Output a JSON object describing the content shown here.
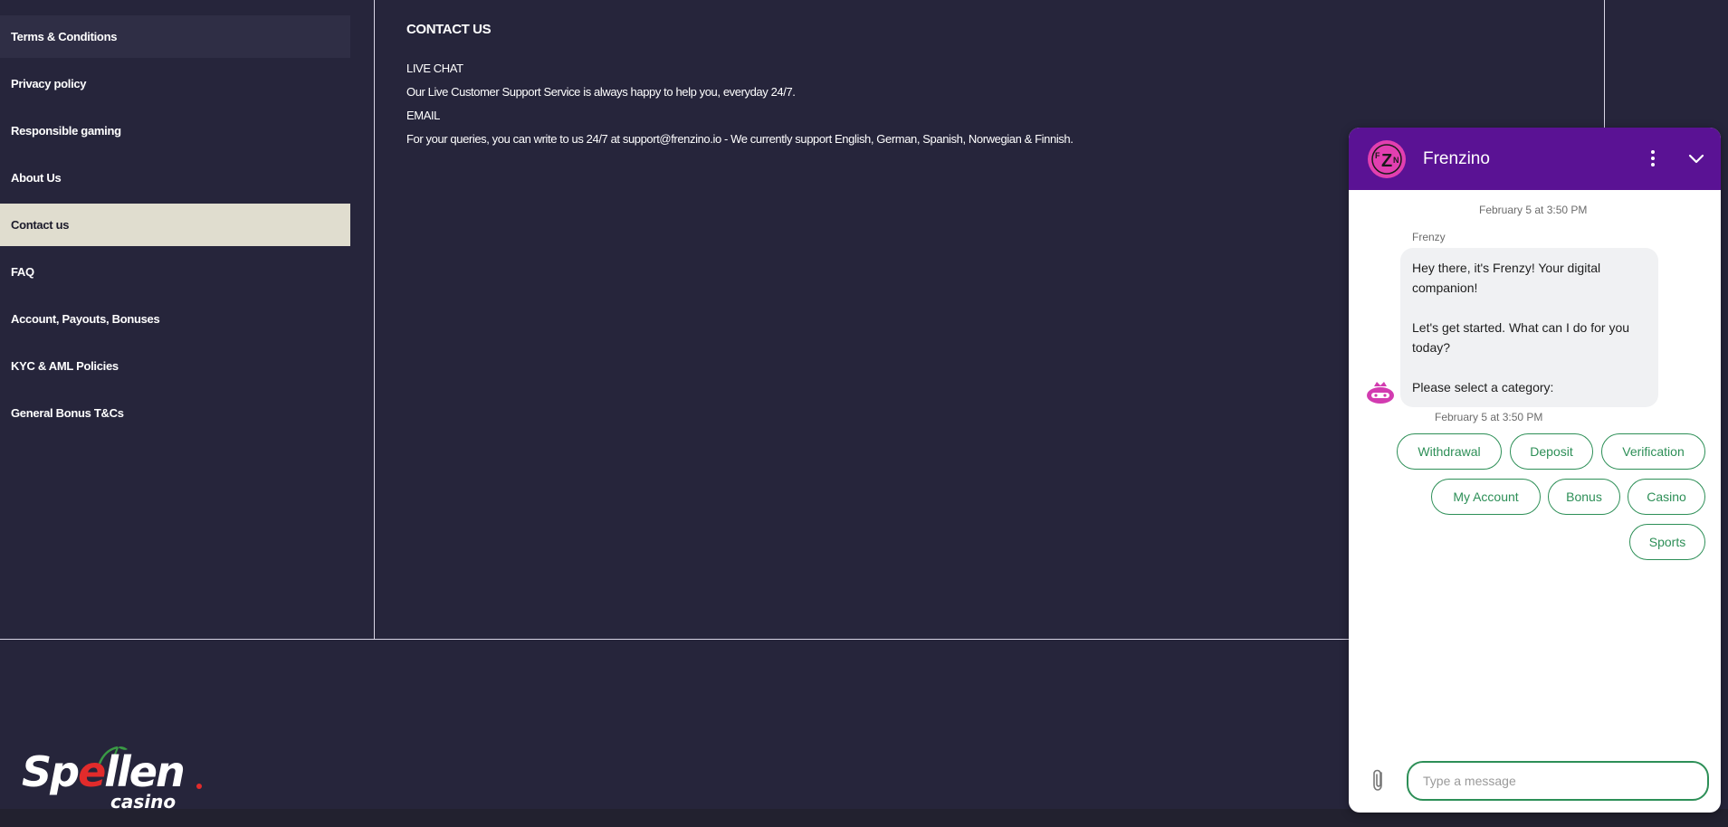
{
  "sidebar": {
    "items": [
      {
        "label": "Terms & Conditions",
        "state": "hover"
      },
      {
        "label": "Privacy policy",
        "state": ""
      },
      {
        "label": "Responsible gaming",
        "state": ""
      },
      {
        "label": "About Us",
        "state": ""
      },
      {
        "label": "Contact us",
        "state": "active"
      },
      {
        "label": "FAQ",
        "state": ""
      },
      {
        "label": "Account, Payouts, Bonuses",
        "state": ""
      },
      {
        "label": "KYC & AML Policies",
        "state": ""
      },
      {
        "label": "General Bonus T&Cs",
        "state": ""
      }
    ]
  },
  "content": {
    "heading": "CONTACT US",
    "live_chat_label": "LIVE CHAT",
    "live_chat_text": "Our Live Customer Support Service is always happy to help you, everyday 24/7.",
    "email_label": "EMAIL",
    "email_text": "For your queries, you can write to us 24/7 at support@frenzino.io - We currently support English, German, Spanish, Norwegian & Finnish."
  },
  "logo": {
    "word_a": "Sp",
    "word_e": "e",
    "word_b": "llen",
    "sub": "casino"
  },
  "chat": {
    "title": "Frenzino",
    "avatar_text": "FZN",
    "icons": {
      "menu": "more-vertical-icon",
      "collapse": "chevron-down-icon",
      "attach": "paperclip-icon"
    },
    "accent_color": "#5a1294",
    "button_color": "#2d8f57",
    "timestamp_top": "February 5 at 3:50 PM",
    "sender": "Frenzy",
    "message": {
      "p1": "Hey there, it's Frenzy! Your digital companion!",
      "p2": "Let's get started. What can I do for you today?",
      "p3": "Please select a category:"
    },
    "timestamp_bottom": "February 5 at 3:50 PM",
    "quick_replies": [
      "Withdrawal",
      "Deposit",
      "Verification",
      "My Account",
      "Bonus",
      "Casino",
      "Sports"
    ],
    "input_placeholder": "Type a message"
  }
}
